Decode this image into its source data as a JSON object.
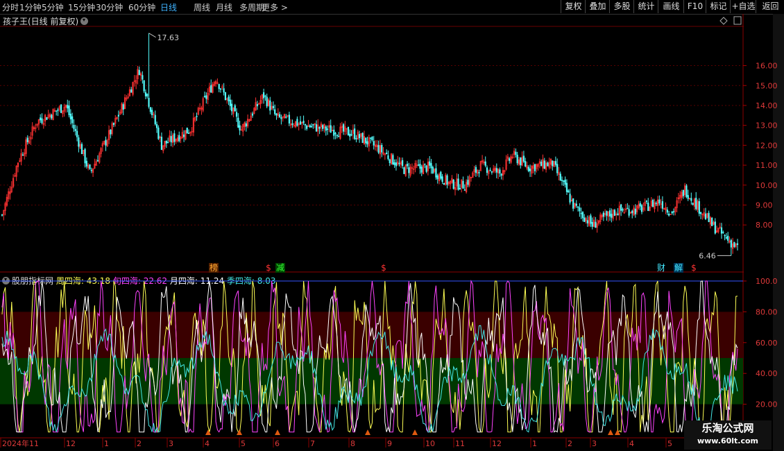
{
  "toolbar": {
    "periods": [
      {
        "label": "分时",
        "active": false
      },
      {
        "label": "1分钟",
        "active": false
      },
      {
        "label": "5分钟",
        "active": false
      },
      {
        "label": "15分钟",
        "active": false
      },
      {
        "label": "30分钟",
        "active": false
      },
      {
        "label": "60分钟",
        "active": false
      },
      {
        "label": "日线",
        "active": true
      },
      {
        "label": "周线",
        "active": false
      },
      {
        "label": "月线",
        "active": false
      },
      {
        "label": "多周期",
        "active": false
      },
      {
        "label": "更多 >",
        "active": false
      }
    ],
    "buttons": [
      "复权",
      "叠加",
      "多股",
      "统计",
      "画线",
      "F10",
      "标记",
      "+自选",
      "返回"
    ]
  },
  "main_chart": {
    "title": "孩子王(日线 前复权)",
    "high_label": "17.63",
    "low_label": "6.46",
    "price_ticks": [
      "16.00",
      "15.00",
      "14.00",
      "13.00",
      "12.00",
      "11.00",
      "10.00",
      "9.00",
      "8.00"
    ],
    "event_markers": [
      "榜",
      "$",
      "减",
      "$",
      "财",
      "解",
      "$"
    ]
  },
  "indicator": {
    "name": "股朋指标网",
    "items": [
      {
        "label": "周四海:",
        "value": "43.18",
        "color": "#ffff55"
      },
      {
        "label": "旬四海:",
        "value": "22.62",
        "color": "#ff44ff"
      },
      {
        "label": "月四海:",
        "value": "11.24",
        "color": "#ffffff"
      },
      {
        "label": "季四海:",
        "value": "8.03",
        "color": "#44e8e8"
      }
    ],
    "ticks": [
      "100.0",
      "80.00",
      "60.00",
      "40.00",
      "20.00"
    ]
  },
  "date_axis": [
    "2024年11",
    "12",
    "1",
    "2",
    "3",
    "4",
    "5",
    "6",
    "7",
    "8",
    "9",
    "10",
    "11",
    "12",
    "1",
    "2",
    "3",
    "4",
    "5"
  ],
  "watermark": {
    "line1": "乐淘公式网",
    "line2": "www.60lt.com"
  },
  "colors": {
    "up": "#ff3232",
    "down": "#54fcfc",
    "accent": "#3fb3ff",
    "red_zone": "#3a0000",
    "green_zone": "#003800"
  },
  "chart_data": {
    "type": "candlestick",
    "price_ylim": [
      6.3,
      17.9
    ],
    "indicator_ylim": [
      0,
      100
    ],
    "anchors_close": [
      [
        0,
        8.5
      ],
      [
        10,
        11.2
      ],
      [
        22,
        13.2
      ],
      [
        40,
        14.0
      ],
      [
        55,
        10.6
      ],
      [
        70,
        13.0
      ],
      [
        86,
        15.8
      ],
      [
        100,
        12.0
      ],
      [
        118,
        12.8
      ],
      [
        134,
        15.4
      ],
      [
        150,
        12.8
      ],
      [
        164,
        14.5
      ],
      [
        172,
        13.4
      ],
      [
        190,
        13.0
      ],
      [
        205,
        12.8
      ],
      [
        220,
        12.6
      ],
      [
        235,
        11.9
      ],
      [
        252,
        10.8
      ],
      [
        268,
        10.9
      ],
      [
        280,
        10.1
      ],
      [
        290,
        10.0
      ],
      [
        300,
        11.0
      ],
      [
        312,
        10.6
      ],
      [
        320,
        11.5
      ],
      [
        330,
        10.9
      ],
      [
        345,
        11.1
      ],
      [
        358,
        9.0
      ],
      [
        370,
        8.0
      ],
      [
        385,
        8.7
      ],
      [
        400,
        8.8
      ],
      [
        412,
        9.2
      ],
      [
        420,
        8.6
      ],
      [
        428,
        9.8
      ],
      [
        445,
        8.0
      ],
      [
        460,
        6.9
      ]
    ],
    "extremes": [
      {
        "index": 92,
        "high": 17.63
      },
      {
        "index": 457,
        "low": 6.46
      }
    ]
  }
}
